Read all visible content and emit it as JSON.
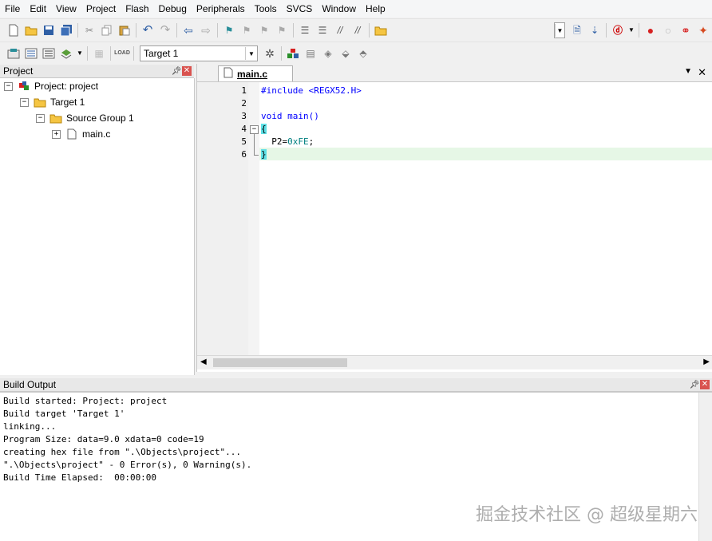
{
  "menu": [
    "File",
    "Edit",
    "View",
    "Project",
    "Flash",
    "Debug",
    "Peripherals",
    "Tools",
    "SVCS",
    "Window",
    "Help"
  ],
  "toolbar": {
    "target_select": "Target 1"
  },
  "project_panel": {
    "title": "Project",
    "tree": {
      "project": "Project: project",
      "target": "Target 1",
      "group": "Source Group 1",
      "file": "main.c"
    }
  },
  "editor": {
    "tab": "main.c",
    "line_numbers": [
      "1",
      "2",
      "3",
      "4",
      "5",
      "6"
    ],
    "code": {
      "l1": "#include <REGX52.H>",
      "l3": "void main()",
      "l4": "{",
      "l5_a": "  P2=",
      "l5_b": "0xFE",
      "l5_c": ";",
      "l6": "}"
    }
  },
  "build_output": {
    "title": "Build Output",
    "lines": [
      "Build started: Project: project",
      "Build target 'Target 1'",
      "linking...",
      "Program Size: data=9.0 xdata=0 code=19",
      "creating hex file from \".\\Objects\\project\"...",
      "\".\\Objects\\project\" - 0 Error(s), 0 Warning(s).",
      "Build Time Elapsed:  00:00:00"
    ]
  },
  "watermark": "掘金技术社区 @ 超级星期六",
  "colors": {
    "accent_blue": "#2f5fa5",
    "keyword": "#0000ff",
    "preproc": "#0000ff",
    "string": "#800080",
    "hex": "#008080",
    "current_line": "#e6f7e6",
    "brace_match": "#5ee0e6"
  },
  "icons": [
    "new-file-icon",
    "open-folder-icon",
    "save-icon",
    "save-all-icon",
    "cut-icon",
    "copy-icon",
    "paste-icon",
    "undo-icon",
    "redo-icon",
    "nav-back-icon",
    "nav-forward-icon",
    "bookmark-icon",
    "indent-icon",
    "outdent-icon",
    "comment-icon",
    "uncomment-icon",
    "find-in-files-icon",
    "debug-icon",
    "build-icon",
    "rebuild-icon",
    "batch-build-icon",
    "download-icon",
    "target-options-icon",
    "run-icon",
    "stop-icon",
    "breakpoint-icon"
  ]
}
